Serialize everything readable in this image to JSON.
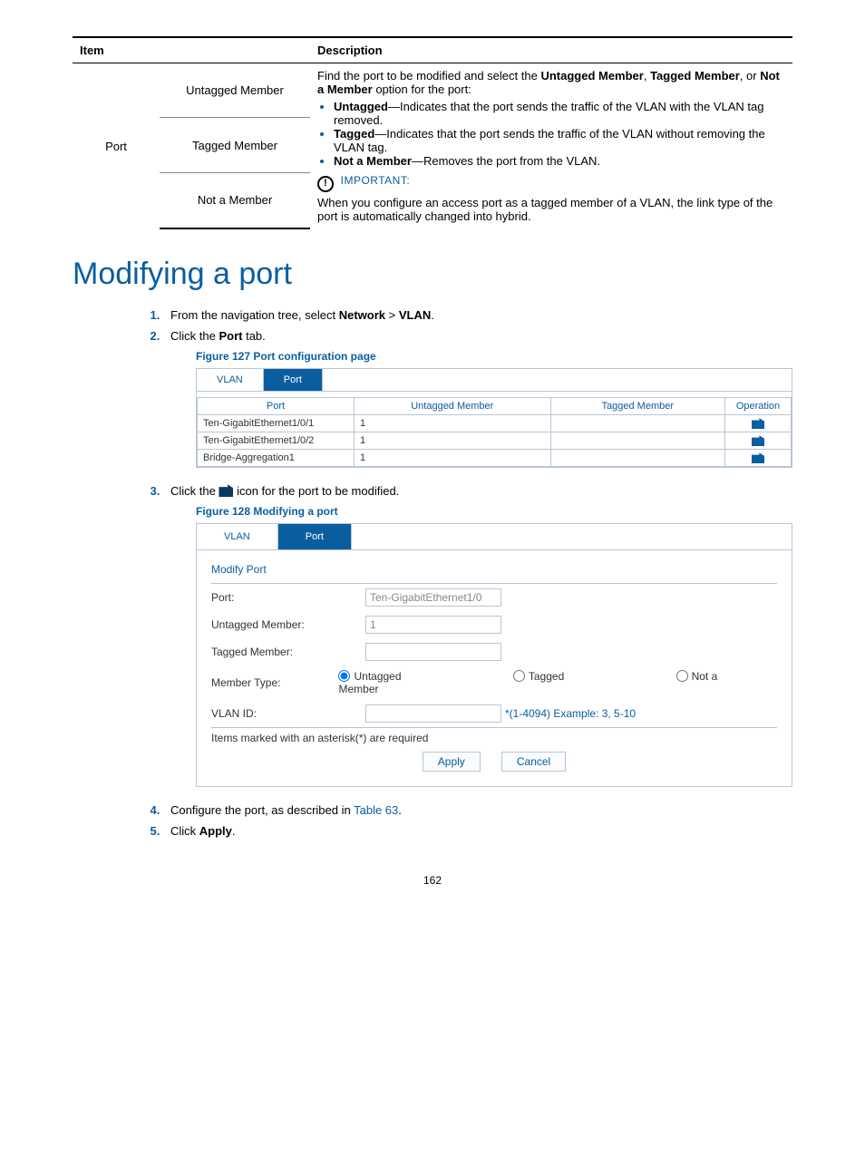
{
  "table1": {
    "headers": {
      "item": "Item",
      "desc": "Description"
    },
    "col1": "Port",
    "rows": [
      "Untagged Member",
      "Tagged Member",
      "Not a Member"
    ],
    "desc": {
      "intro_a": "Find the port to be modified and select the ",
      "b1": "Untagged Member",
      "intro_b": ", ",
      "b2": "Tagged Member",
      "intro_c": ", or ",
      "b3": "Not a Member",
      "intro_d": " option for the port:",
      "li1b": "Untagged",
      "li1": "—Indicates that the port sends the traffic of the VLAN with the VLAN tag removed.",
      "li2b": "Tagged",
      "li2": "—Indicates that the port sends the traffic of the VLAN without removing the VLAN tag.",
      "li3b": "Not a Member",
      "li3": "—Removes the port from the VLAN.",
      "important": "IMPORTANT:",
      "note": "When you configure an access port as a tagged member of a VLAN, the link type of the port is automatically changed into hybrid."
    }
  },
  "heading": "Modifying a port",
  "steps": {
    "s1a": "From the navigation tree, select ",
    "s1b": "Network",
    "s1c": " > ",
    "s1d": "VLAN",
    "s1e": ".",
    "s2a": "Click the ",
    "s2b": "Port",
    "s2c": " tab.",
    "fig127": "Figure 127 Port configuration page",
    "s3a": "Click the ",
    "s3b": " icon for the port to be modified.",
    "fig128": "Figure 128 Modifying a port",
    "s4a": "Configure the port, as described in ",
    "s4link": "Table 63",
    "s4b": ".",
    "s5a": "Click ",
    "s5b": "Apply",
    "s5c": "."
  },
  "shot1": {
    "tabs": {
      "vlan": "VLAN",
      "port": "Port"
    },
    "th": {
      "port": "Port",
      "um": "Untagged Member",
      "tm": "Tagged Member",
      "op": "Operation"
    },
    "rows": [
      {
        "port": "Ten-GigabitEthernet1/0/1",
        "um": "1",
        "tm": ""
      },
      {
        "port": "Ten-GigabitEthernet1/0/2",
        "um": "1",
        "tm": ""
      },
      {
        "port": "Bridge-Aggregation1",
        "um": "1",
        "tm": ""
      }
    ]
  },
  "shot2": {
    "tabs": {
      "vlan": "VLAN",
      "port": "Port"
    },
    "title": "Modify Port",
    "labels": {
      "port": "Port:",
      "um": "Untagged Member:",
      "tm": "Tagged Member:",
      "mt": "Member Type:",
      "vid": "VLAN ID:"
    },
    "values": {
      "port": "Ten-GigabitEthernet1/0",
      "um": "1",
      "tm": "",
      "vid": ""
    },
    "radios": {
      "u": "Untagged",
      "t": "Tagged",
      "n": "Not a Member"
    },
    "vid_hint": "*(1-4094) Example: 3, 5-10",
    "req": "Items marked with an asterisk(*) are required",
    "apply": "Apply",
    "cancel": "Cancel"
  },
  "pagenum": "162"
}
